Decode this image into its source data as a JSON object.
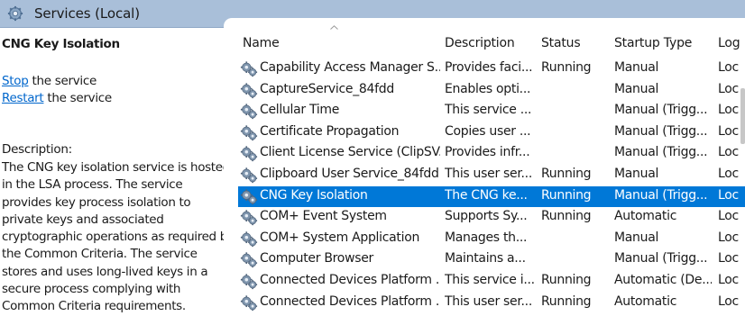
{
  "header": {
    "title": "Services (Local)",
    "icon": "gear-icon"
  },
  "detail": {
    "service_name": "CNG Key Isolation",
    "stop_link": "Stop",
    "stop_suffix": " the service",
    "restart_link": "Restart",
    "restart_suffix": " the service",
    "description_label": "Description:",
    "description_text": "The CNG key isolation service is hosted in the LSA process. The service provides key process isolation to private keys and associated cryptographic operations as required by the Common Criteria. The service stores and uses long-lived keys in a secure process complying with Common Criteria requirements."
  },
  "table": {
    "columns": {
      "name": "Name",
      "description": "Description",
      "status": "Status",
      "startup": "Startup Type",
      "logon": "Log"
    },
    "rows": [
      {
        "name": "Capability Access Manager S...",
        "description": "Provides faci...",
        "status": "Running",
        "startup": "Manual",
        "logon": "Loc"
      },
      {
        "name": "CaptureService_84fdd",
        "description": "Enables opti...",
        "status": "",
        "startup": "Manual",
        "logon": "Loc"
      },
      {
        "name": "Cellular Time",
        "description": "This service ...",
        "status": "",
        "startup": "Manual (Trigg...",
        "logon": "Loc"
      },
      {
        "name": "Certificate Propagation",
        "description": "Copies user ...",
        "status": "",
        "startup": "Manual (Trigg...",
        "logon": "Loc"
      },
      {
        "name": "Client License Service (ClipSV...",
        "description": "Provides infr...",
        "status": "",
        "startup": "Manual (Trigg...",
        "logon": "Loc"
      },
      {
        "name": "Clipboard User Service_84fdd",
        "description": "This user ser...",
        "status": "Running",
        "startup": "Manual",
        "logon": "Loc"
      },
      {
        "name": "CNG Key Isolation",
        "description": "The CNG ke...",
        "status": "Running",
        "startup": "Manual (Trigg...",
        "logon": "Loc"
      },
      {
        "name": "COM+ Event System",
        "description": "Supports Sy...",
        "status": "Running",
        "startup": "Automatic",
        "logon": "Loc"
      },
      {
        "name": "COM+ System Application",
        "description": "Manages th...",
        "status": "",
        "startup": "Manual",
        "logon": "Loc"
      },
      {
        "name": "Computer Browser",
        "description": "Maintains a...",
        "status": "",
        "startup": "Manual (Trigg...",
        "logon": "Loc"
      },
      {
        "name": "Connected Devices Platform ...",
        "description": "This service i...",
        "status": "Running",
        "startup": "Automatic (De...",
        "logon": "Loc"
      },
      {
        "name": "Connected Devices Platform ...",
        "description": "This user ser...",
        "status": "Running",
        "startup": "Automatic",
        "logon": "Loc"
      }
    ]
  },
  "selected_row": "CNG Key Isolation",
  "colors": {
    "selection": "#0078d7",
    "header_bar": "#a9bfd9",
    "link": "#0066cc"
  }
}
